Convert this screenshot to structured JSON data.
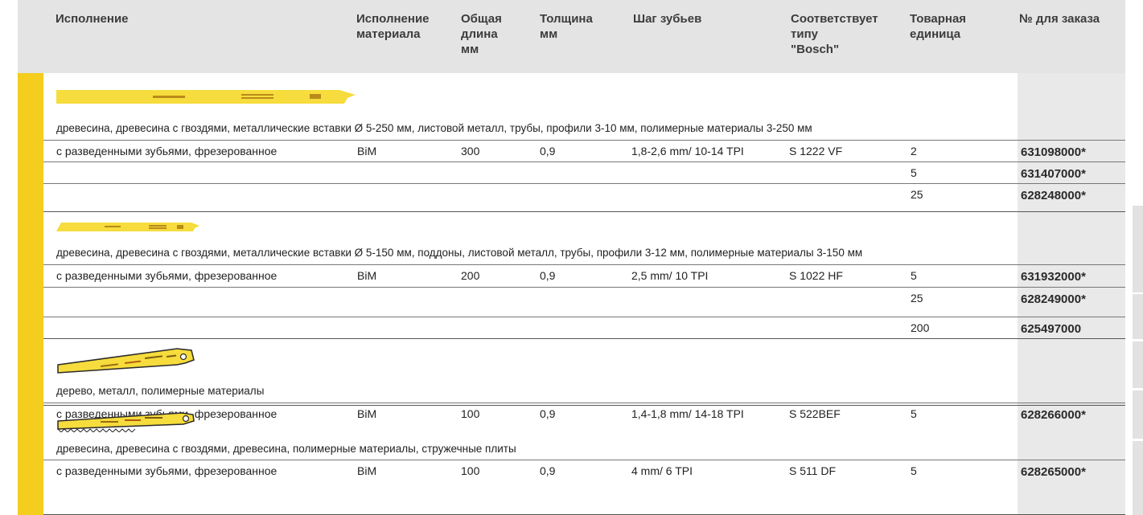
{
  "headers": {
    "execution": "Исполнение",
    "material": "Исполнение\nматериала",
    "length": "Общая\nдлина\nмм",
    "thickness": "Толщина\nмм",
    "tooth_pitch": "Шаг зубьев",
    "bosch": "Соответствует\nтипу\n\"Bosch\"",
    "unit": "Товарная\nединица",
    "order_no": "№ для заказа"
  },
  "groups": [
    {
      "description": "древесина, древесина с гвоздями, металлические вставки Ø 5-250 мм, листовой металл, трубы, профили 3-10 мм, полимерные материалы 3-250 мм",
      "rows": [
        {
          "execution": "с разведенными зубьями, фрезерованное",
          "material": "BiM",
          "length": "300",
          "thickness": "0,9",
          "pitch": "1,8-2,6 mm/ 10-14 TPI",
          "bosch": "S 1222 VF",
          "unit": "2",
          "order": "631098000*"
        },
        {
          "unit": "5",
          "order": "631407000*"
        },
        {
          "unit": "25",
          "order": "628248000*"
        }
      ]
    },
    {
      "description": "древесина, древесина с гвоздями, металлические вставки Ø 5-150 мм, поддоны, листовой металл, трубы, профили 3-12 мм, полимерные материалы 3-150 мм",
      "rows": [
        {
          "execution": "с разведенными зубьями, фрезерованное",
          "material": "BiM",
          "length": "200",
          "thickness": "0,9",
          "pitch": "2,5 mm/ 10 TPI",
          "bosch": "S 1022 HF",
          "unit": "5",
          "order": "631932000*"
        },
        {
          "unit": "25",
          "order": "628249000*"
        },
        {
          "unit": "200",
          "order": "625497000"
        }
      ]
    },
    {
      "description": "дерево, металл, полимерные материалы",
      "rows": [
        {
          "execution": "с разведенными зубьями, фрезерованное",
          "material": "BiM",
          "length": "100",
          "thickness": "0,9",
          "pitch": "1,4-1,8 mm/ 14-18 TPI",
          "bosch": "S 522BEF",
          "unit": "5",
          "order": "628266000*"
        }
      ]
    },
    {
      "description": "древесина, древесина с гвоздями, древесина, полимерные материалы, стружечные плиты",
      "rows": [
        {
          "execution": "с разведенными зубьями, фрезерованное",
          "material": "BiM",
          "length": "100",
          "thickness": "0,9",
          "pitch": "4 mm/ 6 TPI",
          "bosch": "S 511 DF",
          "unit": "5",
          "order": "628265000*"
        }
      ]
    }
  ],
  "colors": {
    "accent_yellow": "#f4cd1e",
    "header_gray": "#e4e4e4",
    "order_col_gray": "#e9e9e9"
  },
  "icons": {
    "blade": "saw-blade-icon"
  }
}
